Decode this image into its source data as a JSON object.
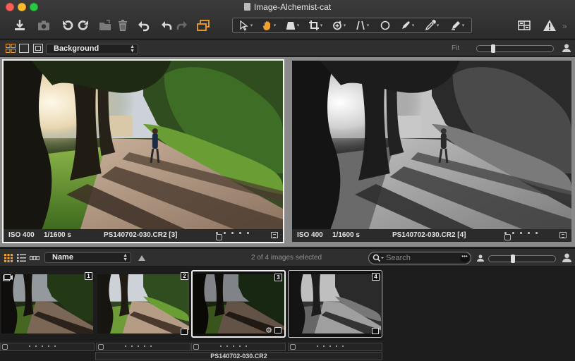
{
  "window": {
    "title": "Image-Alchemist-cat"
  },
  "toolbar": {
    "left_icons": [
      "download-icon",
      "camera-icon",
      "rotate-left-icon",
      "rotate-right-icon",
      "folder-move-icon",
      "trash-icon",
      "reset-icon",
      "undo-icon",
      "redo-icon",
      "variants-icon"
    ],
    "tools": [
      "select-cursor",
      "hand-pan",
      "keystone",
      "crop",
      "rotate-straighten",
      "keystone-lines",
      "spot-circle",
      "brush",
      "color-picker",
      "annotation"
    ],
    "right_icons": [
      "viewer-layout-icon",
      "warning-icon"
    ],
    "accent": "#f0a030"
  },
  "viewer_bar": {
    "background_select": "Background",
    "fit_label": "Fit",
    "zoom_fraction": 0.2
  },
  "viewer": {
    "panes": [
      {
        "iso": "ISO 400",
        "shutter": "1/1600 s",
        "filename": "PS140702-030.CR2 [3]"
      },
      {
        "iso": "ISO 400",
        "shutter": "1/1600 s",
        "filename": "PS140702-030.CR2 [4]"
      }
    ]
  },
  "browser_bar": {
    "sort_select": "Name",
    "selection_count": "2 of 4 images selected",
    "search_placeholder": "Search",
    "thumb_size_fraction": 0.35
  },
  "thumbnails": [
    {
      "badge": "1"
    },
    {
      "badge": "2"
    },
    {
      "badge": "3"
    },
    {
      "badge": "4"
    }
  ],
  "filename_strip": "PS140702-030.CR2"
}
